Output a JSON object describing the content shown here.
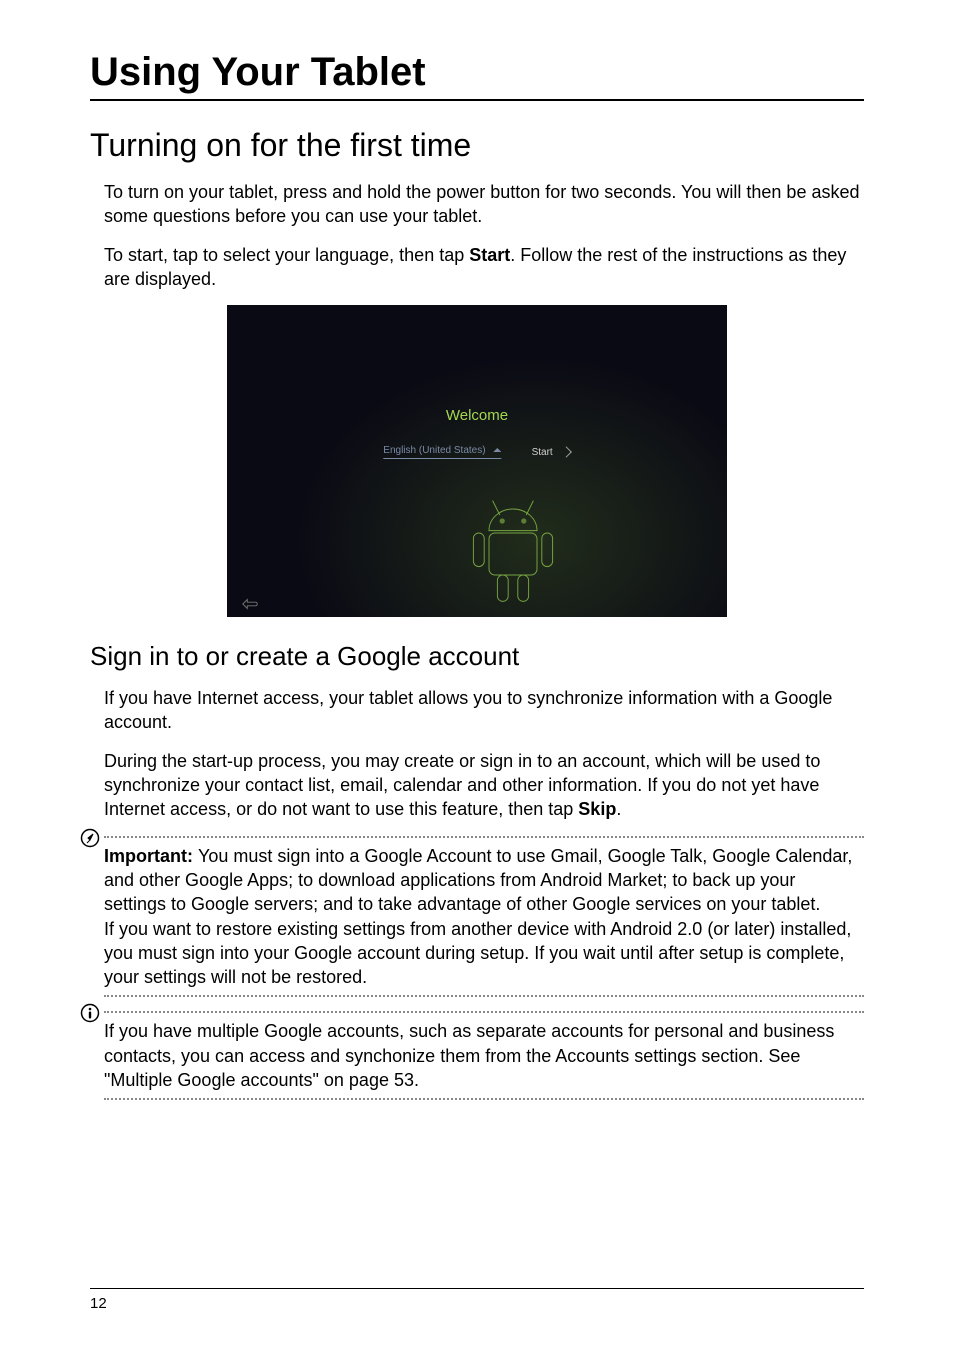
{
  "page": {
    "title": "Using Your Tablet",
    "number": "12"
  },
  "section1": {
    "heading": "Turning on for the first time",
    "p1": "To turn on your tablet, press and hold the power button for two seconds. You will then be asked some questions before you can use your tablet.",
    "p2_a": "To start, tap to select your language, then tap ",
    "p2_b": "Start",
    "p2_c": ". Follow the rest of the instructions as they are displayed."
  },
  "screenshot": {
    "welcome": "Welcome",
    "language": "English (United States)",
    "start": "Start"
  },
  "section2": {
    "heading": "Sign in to or create a Google account",
    "p1": "If you have Internet access, your tablet allows you to synchronize information with a Google account.",
    "p2_a": "During the start-up process, you may create or sign in to an account, which will be used to synchronize your contact list, email, calendar and other information. If you do not yet have Internet access, or do not want to use this feature, then tap ",
    "p2_b": "Skip",
    "p2_c": "."
  },
  "note1": {
    "bold": "Important: ",
    "text1": "You must sign into a Google Account to use Gmail, Google Talk, Google Calendar, and other Google Apps; to download applications from Android Market; to back up your settings to Google servers; and to take advantage of other Google services on your tablet.",
    "text2": "If you want to restore existing settings from another device with Android 2.0 (or later) installed, you must sign into your Google account during setup. If you wait until after setup is complete, your settings will not be restored."
  },
  "note2": {
    "text": "If you have multiple Google accounts, such as separate accounts for personal and business contacts, you can access and synchonize them from the Accounts settings section. See \"Multiple Google accounts\" on page 53."
  }
}
